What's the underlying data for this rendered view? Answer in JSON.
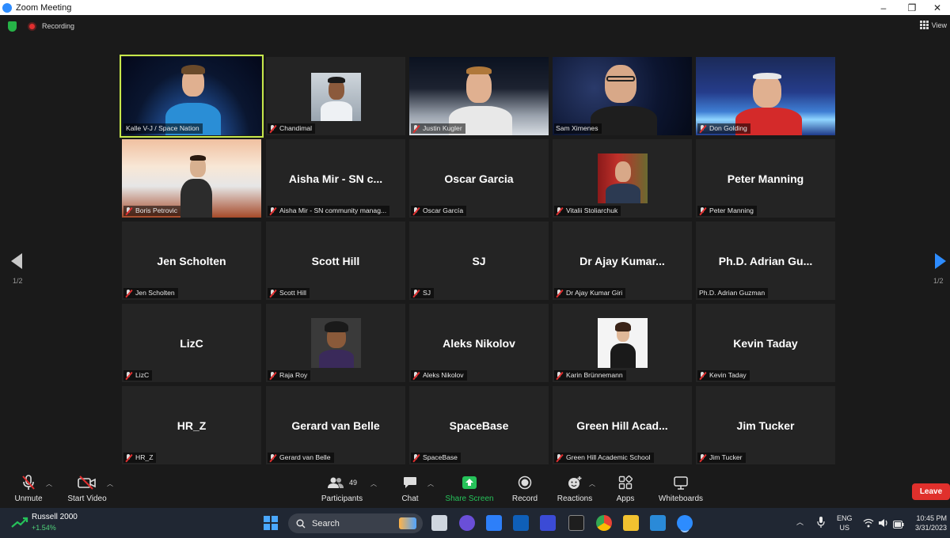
{
  "window": {
    "title": "Zoom Meeting",
    "controls": [
      "–",
      "❐",
      "✕"
    ]
  },
  "status": {
    "recording_label": "Recording",
    "view_label": "View",
    "colors": {
      "shield": "#26b247",
      "record": "#e02f2f"
    }
  },
  "tiles": [
    {
      "name": "Kalle V-J / Space Nation",
      "video": true,
      "speaking": true,
      "muted": false
    },
    {
      "name": "Chandimal",
      "video": true,
      "muted": true
    },
    {
      "name": "Justin Kugler",
      "video": true,
      "muted": true
    },
    {
      "name": "Sam Ximenes",
      "video": true,
      "muted": false
    },
    {
      "name": "Don Golding",
      "video": true,
      "muted": true
    },
    {
      "name": "Boris Petrovic",
      "video": true,
      "muted": true
    },
    {
      "name": "Aisha Mir - SN community manag...",
      "display": "Aisha Mir  - SN c...",
      "muted": true
    },
    {
      "name": "Oscar García",
      "display": "Oscar Garcia",
      "muted": true
    },
    {
      "name": "Vitalii Stoliarchuk",
      "video": true,
      "muted": true
    },
    {
      "name": "Peter Manning",
      "display": "Peter Manning",
      "muted": true
    },
    {
      "name": "Jen Scholten",
      "display": "Jen Scholten",
      "muted": true
    },
    {
      "name": "Scott Hill",
      "display": "Scott Hill",
      "muted": true
    },
    {
      "name": "SJ",
      "display": "SJ",
      "muted": true
    },
    {
      "name": "Dr Ajay Kumar Giri",
      "display": "Dr Ajay  Kumar...",
      "muted": true
    },
    {
      "name": "Ph.D. Adrian Guzman",
      "display": "Ph.D. Adrian Gu...",
      "muted": false
    },
    {
      "name": "LizC",
      "display": "LizC",
      "muted": true
    },
    {
      "name": "Raja Roy",
      "video": true,
      "muted": true
    },
    {
      "name": "Aleks Nikolov",
      "display": "Aleks Nikolov",
      "muted": true
    },
    {
      "name": "Karin Brünnemann",
      "video": true,
      "muted": true
    },
    {
      "name": "Kevin Taday",
      "display": "Kevin Taday",
      "muted": true
    },
    {
      "name": "HR_Z",
      "display": "HR_Z",
      "muted": true
    },
    {
      "name": "Gerard van Belle",
      "display": "Gerard van Belle",
      "muted": true
    },
    {
      "name": "SpaceBase",
      "display": "SpaceBase",
      "muted": true
    },
    {
      "name": "Green Hill  Academic School",
      "display": "Green Hill  Acad...",
      "muted": true
    },
    {
      "name": "Jim Tucker",
      "display": "Jim Tucker",
      "muted": true
    }
  ],
  "pagination": {
    "left": "1/2",
    "right": "1/2"
  },
  "toolbar": {
    "unmute": "Unmute",
    "start_video": "Start Video",
    "participants": "Participants",
    "participants_count": "49",
    "chat": "Chat",
    "share_screen": "Share Screen",
    "record": "Record",
    "reactions": "Reactions",
    "apps": "Apps",
    "whiteboards": "Whiteboards",
    "leave": "Leave",
    "colors": {
      "share": "#26c25a",
      "leave": "#e0302c"
    }
  },
  "taskbar": {
    "stock_name": "Russell 2000",
    "stock_change": "+1.54%",
    "search_label": "Search",
    "lang": "ENG",
    "region": "US",
    "time": "10:45 PM",
    "date": "3/31/2023"
  }
}
